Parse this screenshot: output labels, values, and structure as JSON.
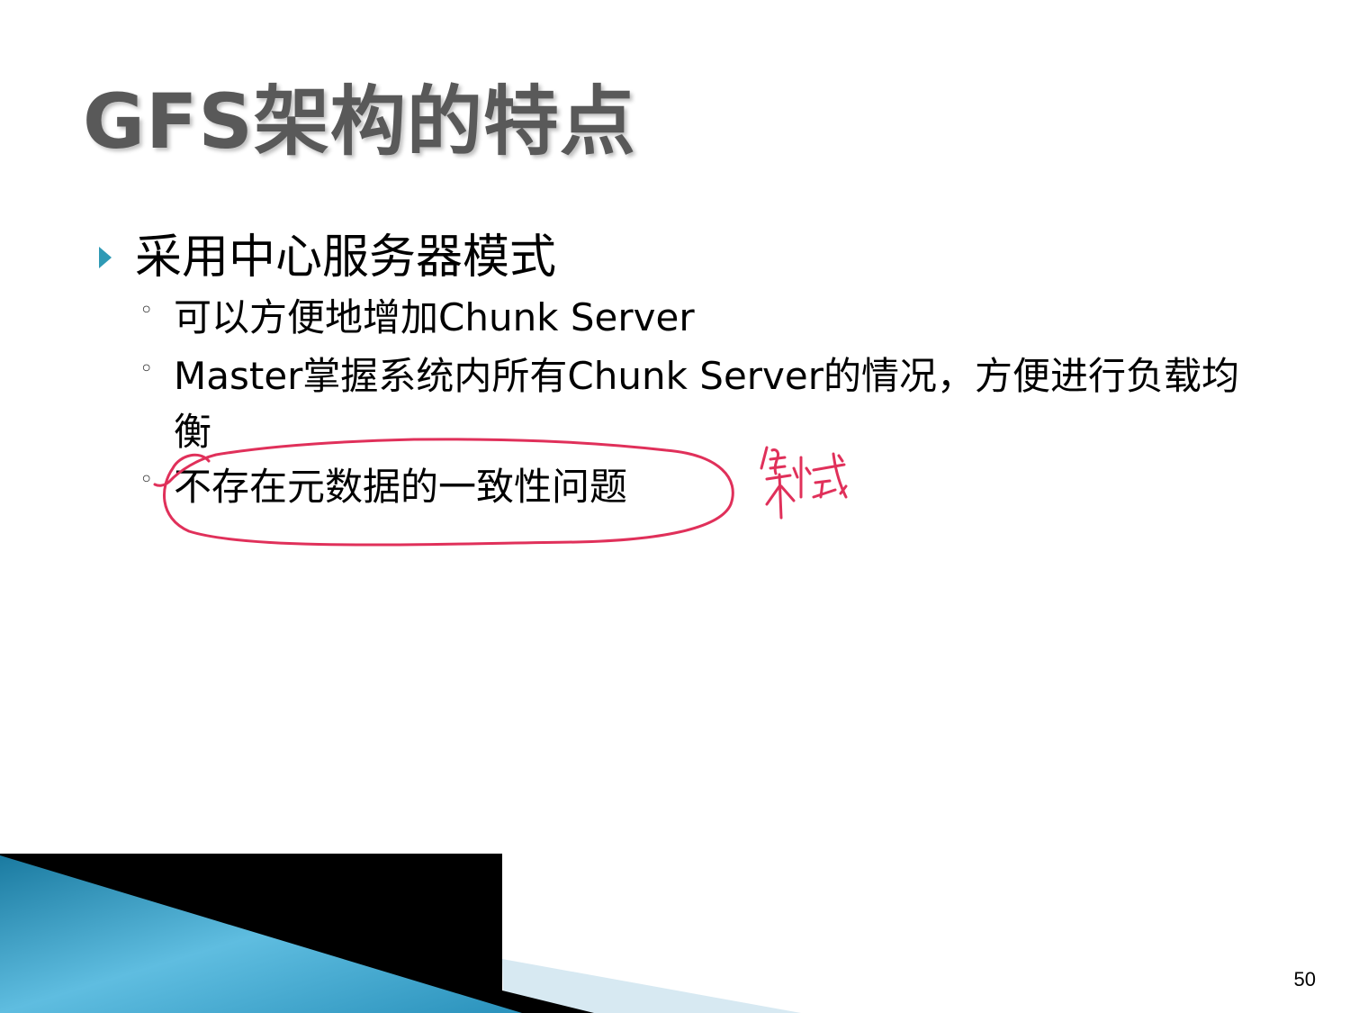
{
  "slide": {
    "title": "GFS架构的特点",
    "bullets": [
      {
        "text": "采用中心服务器模式",
        "sub": [
          "可以方便地增加Chunk Server",
          "Master掌握系统内所有Chunk Server的情况，方便进行负载均衡",
          "不存在元数据的一致性问题"
        ]
      }
    ],
    "page_number": "50"
  },
  "annotations": {
    "handwritten_note": "集中式",
    "ink_color": "#e0305a"
  },
  "colors": {
    "title": "#595959",
    "bullet_marker": "#2f9ab5",
    "deco_blue": "#3aa3c8",
    "deco_light": "#d7e9f2",
    "deco_black": "#000000"
  }
}
